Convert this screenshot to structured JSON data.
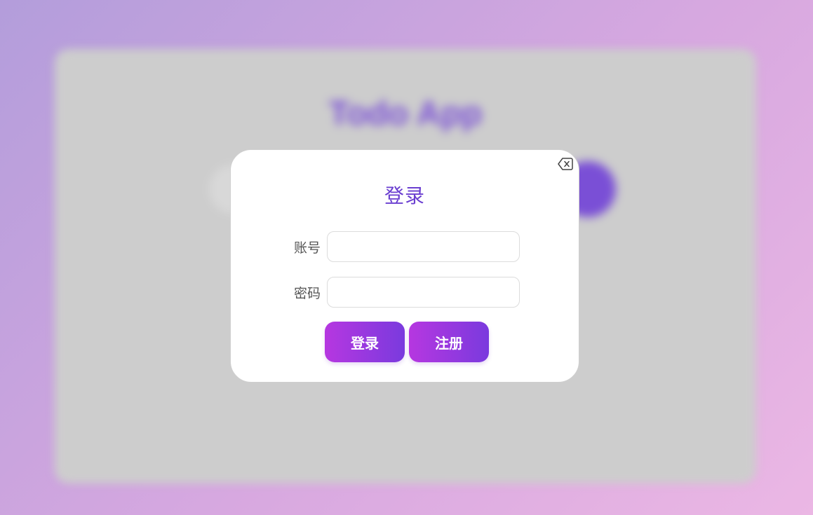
{
  "background_app": {
    "title": "Todo App"
  },
  "login_modal": {
    "title": "登录",
    "close_icon": "backspace-x-icon",
    "account_label": "账号",
    "account_value": "",
    "password_label": "密码",
    "password_value": "",
    "login_button": "登录",
    "register_button": "注册"
  },
  "colors": {
    "accent": "#6a3ed0",
    "button_gradient_start": "#b637e0",
    "button_gradient_end": "#7a3ade",
    "background_gradient_start": "#b39ddb",
    "background_gradient_end": "#ebb7e4"
  }
}
